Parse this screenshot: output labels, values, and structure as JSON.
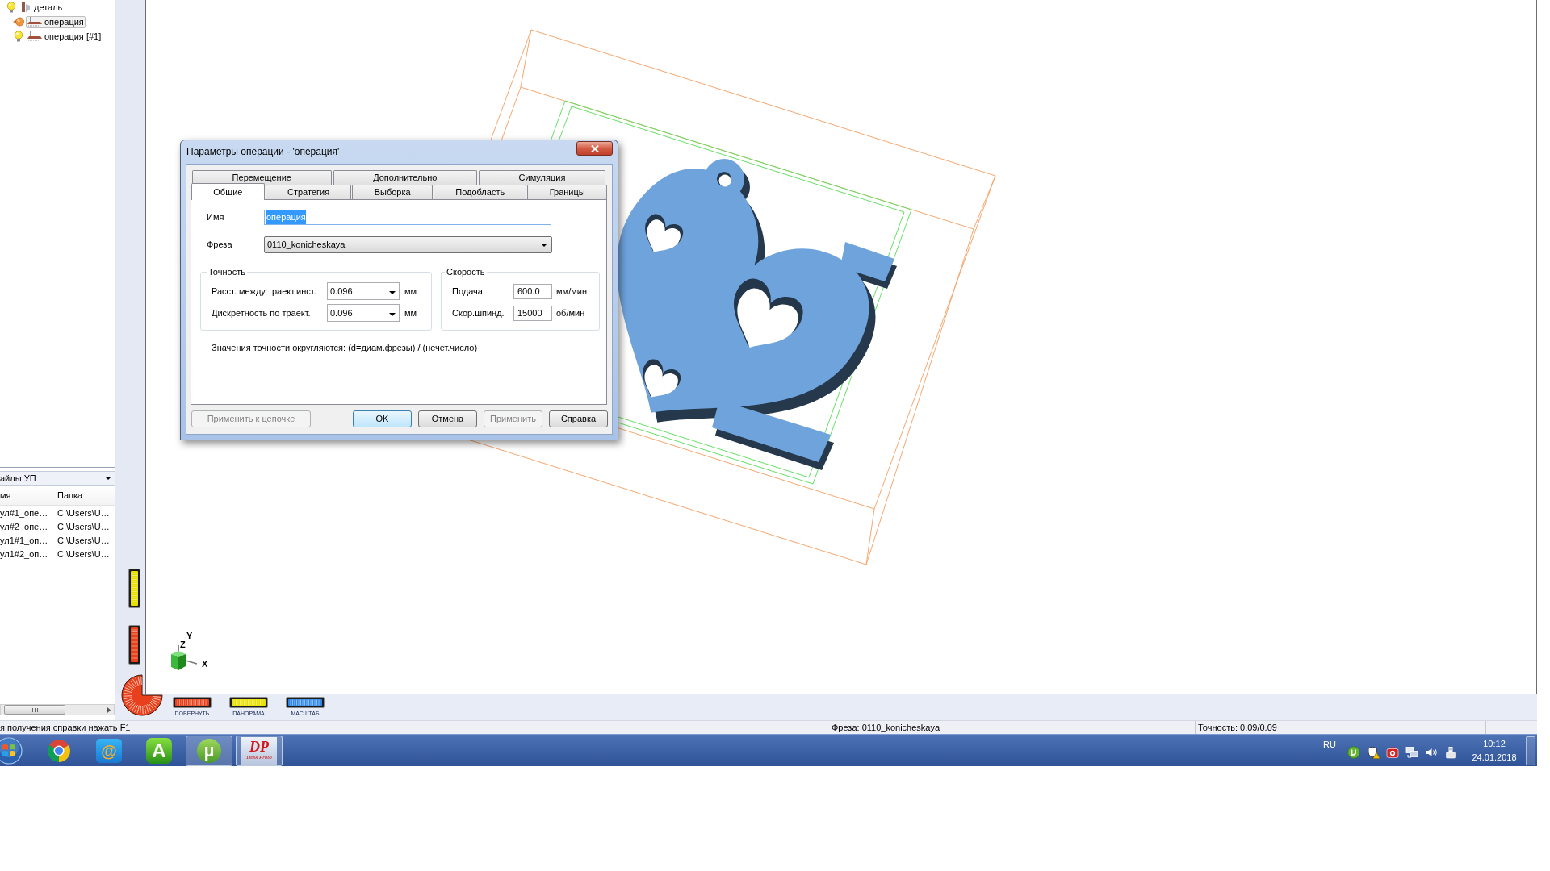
{
  "tree": [
    {
      "label": "деталь",
      "selected": false,
      "children": [
        {
          "label": "операция",
          "selected": true
        },
        {
          "label": "операция [#1]",
          "selected": false
        }
      ]
    }
  ],
  "files_panel": {
    "title": "айлы УП",
    "columns": [
      "мя",
      "Папка"
    ],
    "rows": [
      [
        "ул#1_опе…",
        "C:\\Users\\U…"
      ],
      [
        "ул#2_опе…",
        "C:\\Users\\U…"
      ],
      [
        "ул1#1_оп…",
        "C:\\Users\\U…"
      ],
      [
        "ул1#2_оп…",
        "C:\\Users\\U…"
      ]
    ]
  },
  "viewport": {
    "axis_labels": [
      "Y",
      "Z",
      "X"
    ]
  },
  "view_controls": [
    {
      "label": "ПОВЕРНУТЬ",
      "color": "#e8401c"
    },
    {
      "label": "ПАНОРАМА",
      "color": "#e8e000"
    },
    {
      "label": "МАСШТАБ",
      "color": "#2f88ea"
    }
  ],
  "dialog": {
    "title": "Параметры операции - 'операция'",
    "tab_rows": [
      [
        {
          "label": "Перемещение",
          "selected": false
        },
        {
          "label": "Дополнительно",
          "selected": false
        },
        {
          "label": "Симуляция",
          "selected": false
        }
      ],
      [
        {
          "label": "Общие",
          "selected": true
        },
        {
          "label": "Стратегия",
          "selected": false
        },
        {
          "label": "Выборка",
          "selected": false
        },
        {
          "label": "Подобласть",
          "selected": false
        },
        {
          "label": "Границы",
          "selected": false
        }
      ]
    ],
    "name_field": {
      "label": "Имя",
      "value": "операция",
      "value_selected": true
    },
    "cutter_field": {
      "label": "Фреза",
      "value": "0110_konicheskaya"
    },
    "accuracy_group": {
      "title": "Точность",
      "rows": [
        {
          "label": "Расст. между траект.инст.",
          "value": "0.096",
          "unit": "мм"
        },
        {
          "label": "Дискретность по траект.",
          "value": "0.096",
          "unit": "мм"
        }
      ]
    },
    "speed_group": {
      "title": "Скорость",
      "rows": [
        {
          "label": "Подача",
          "value": "600.0",
          "unit": "мм/мин"
        },
        {
          "label": "Скор.шпинд.",
          "value": "15000",
          "unit": "об/мин"
        }
      ]
    },
    "note": "Значения точности округляются: (d=диам.фрезы) / (нечет.число)",
    "buttons": [
      {
        "label": "Применить к цепочке",
        "disabled": true,
        "default": false
      },
      {
        "label": "OK",
        "disabled": false,
        "default": true
      },
      {
        "label": "Отмена",
        "disabled": false,
        "default": false
      },
      {
        "label": "Применить",
        "disabled": true,
        "default": false
      },
      {
        "label": "Справка",
        "disabled": false,
        "default": false
      }
    ]
  },
  "status_bar": [
    "я получения справки нажать F1",
    "Фреза: 0110_konicheskaya",
    "Точность: 0.09/0.09"
  ],
  "taskbar": {
    "apps": [
      {
        "kind": "browser",
        "open": false
      },
      {
        "kind": "mail",
        "glyph": "@",
        "open": false
      },
      {
        "kind": "letter",
        "glyph": "A",
        "open": false
      },
      {
        "kind": "torrent",
        "glyph": "µ",
        "open": true
      },
      {
        "kind": "deskproto",
        "glyph": "DP",
        "caption": "Desk Proto",
        "open": true
      }
    ],
    "language": "RU",
    "time": "10:12",
    "date": "24.01.2018"
  }
}
